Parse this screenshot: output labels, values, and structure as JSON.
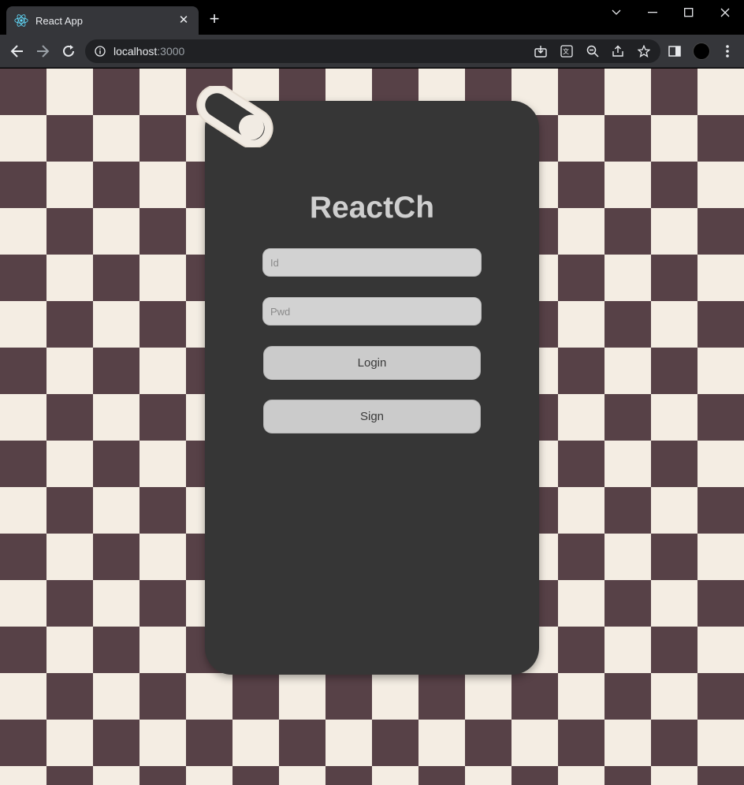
{
  "browser": {
    "tab_title": "React App",
    "new_tab_symbol": "+",
    "tab_close_symbol": "✕",
    "url_host": "localhost",
    "url_port": ":3000"
  },
  "icons": [
    "react-favicon",
    "back-arrow",
    "forward-arrow",
    "reload",
    "info",
    "install-app",
    "translate",
    "zoom-out",
    "share",
    "bookmark-star",
    "side-panel",
    "profile",
    "menu-kebab",
    "minimize",
    "maximize",
    "close",
    "chevron-down"
  ],
  "page": {
    "title": "ReactCh",
    "id_placeholder": "Id",
    "pwd_placeholder": "Pwd",
    "login_label": "Login",
    "sign_label": "Sign"
  },
  "colors": {
    "checker_dark": "#574147",
    "checker_light": "#f4ede3",
    "card_bg": "#363636",
    "control_bg": "#d2d2d2"
  }
}
